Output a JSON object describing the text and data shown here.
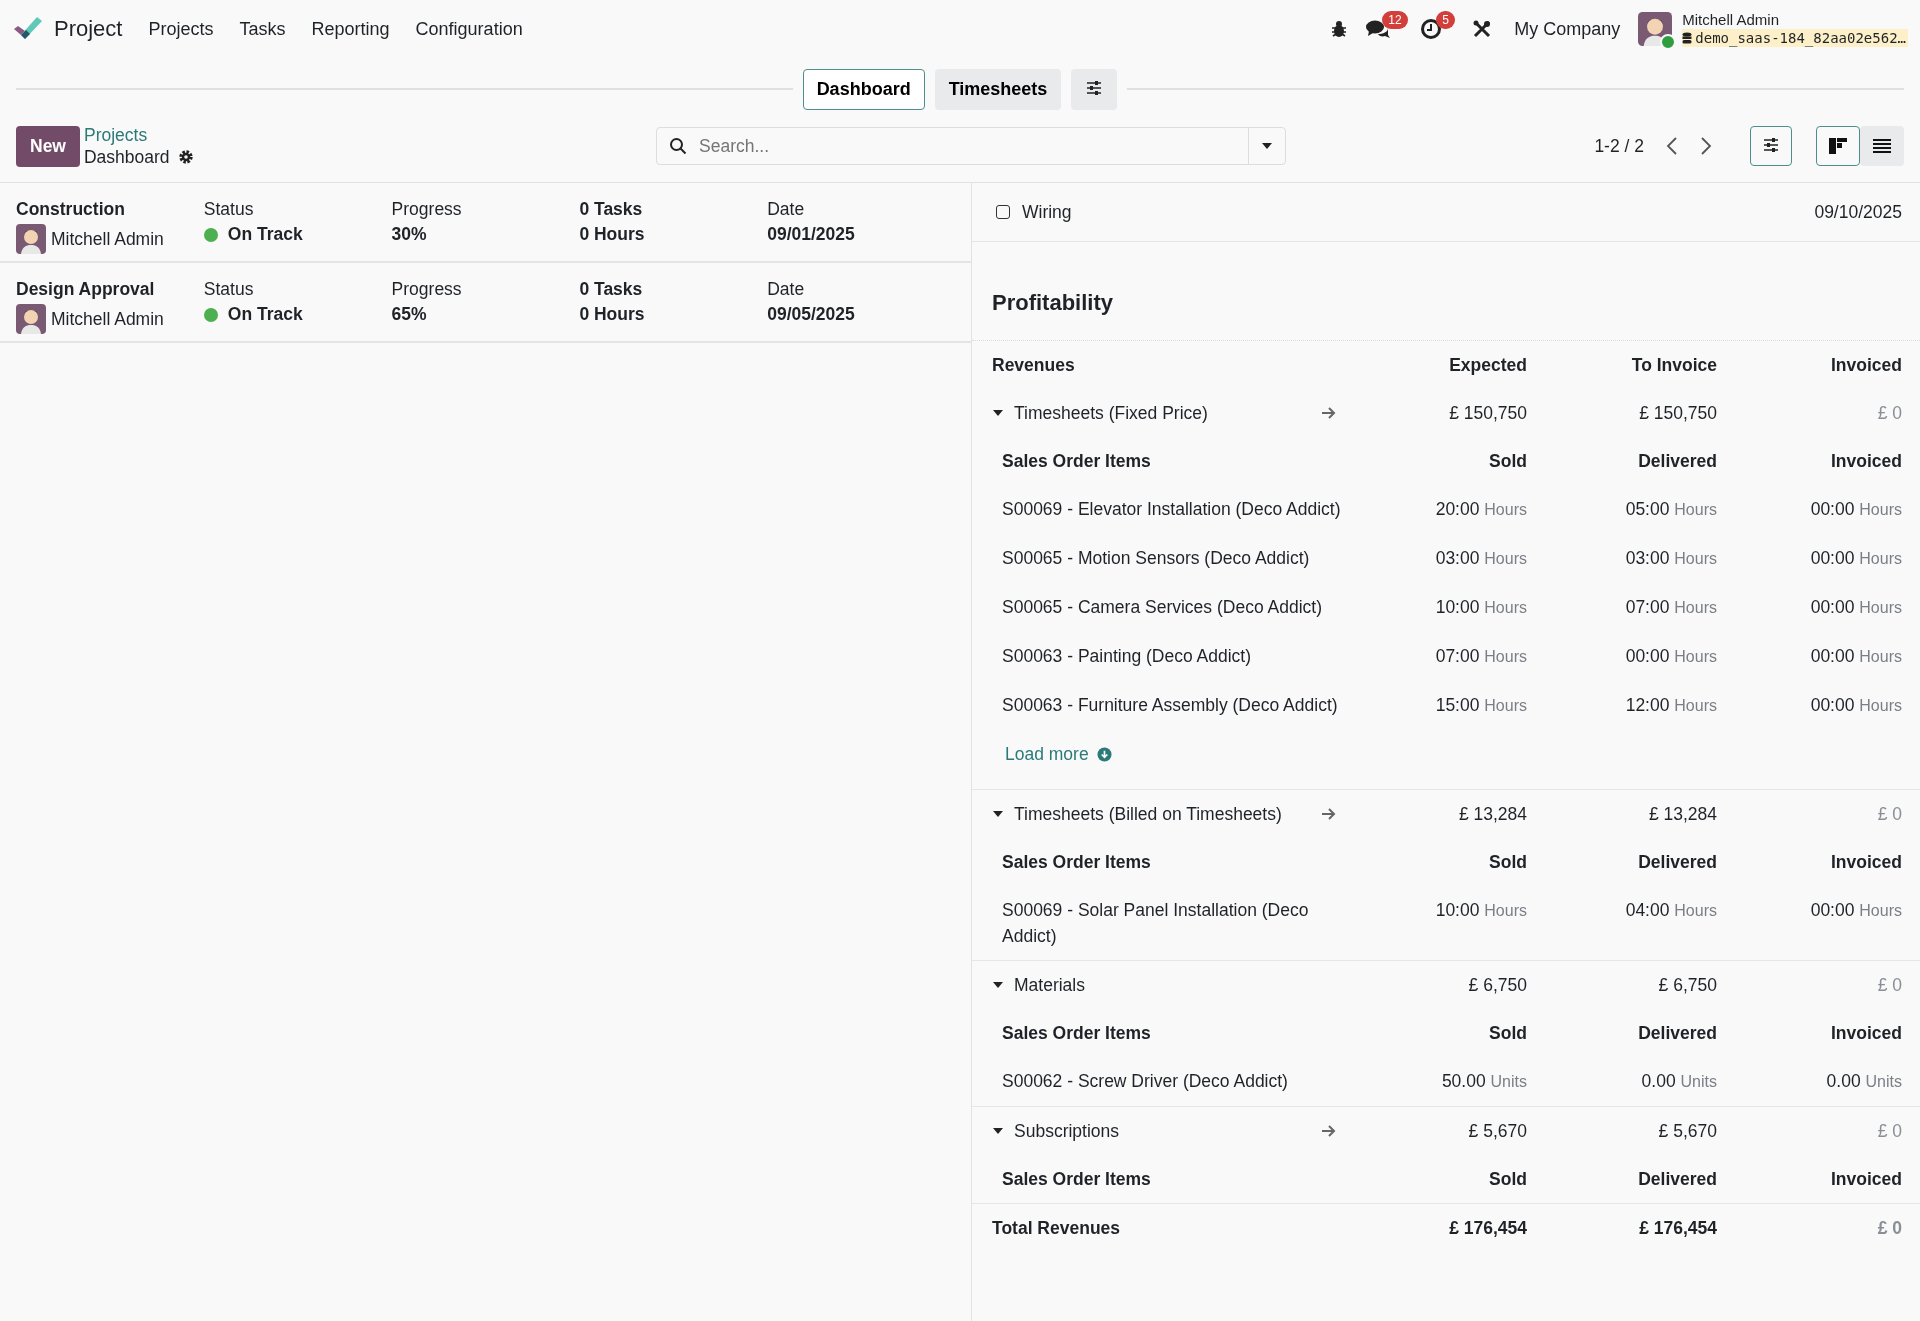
{
  "navbar": {
    "app_name": "Project",
    "menu": [
      "Projects",
      "Tasks",
      "Reporting",
      "Configuration"
    ],
    "messages_badge": "12",
    "activities_badge": "5",
    "company": "My Company",
    "user_name": "Mitchell Admin",
    "database": "demo_saas-184_82aa02e562…"
  },
  "view_tabs": [
    {
      "label": "Dashboard",
      "selected": true
    },
    {
      "label": "Timesheets",
      "selected": false
    }
  ],
  "control_panel": {
    "new_button": "New",
    "breadcrumb_parent": "Projects",
    "breadcrumb_current": "Dashboard",
    "search_placeholder": "Search...",
    "pager": "1-2 / 2",
    "views": [
      {
        "kind": "kanban",
        "selected": true
      },
      {
        "kind": "list",
        "selected": false
      }
    ]
  },
  "projects": [
    {
      "name": "Construction",
      "manager": "Mitchell Admin",
      "status_label": "Status",
      "status": "On Track",
      "color": "#4caf50",
      "progress_label": "Progress",
      "progress": "30%",
      "tasks": "0 Tasks",
      "hours": "0 Hours",
      "date_label": "Date",
      "date": "09/01/2025"
    },
    {
      "name": "Design Approval",
      "manager": "Mitchell Admin",
      "status_label": "Status",
      "status": "On Track",
      "color": "#4caf50",
      "progress_label": "Progress",
      "progress": "65%",
      "tasks": "0 Tasks",
      "hours": "0 Hours",
      "date_label": "Date",
      "date": "09/05/2025"
    }
  ],
  "milestone": {
    "name": "Wiring",
    "checked": false,
    "date": "09/10/2025"
  },
  "profitability": {
    "title": "Profitability",
    "columns": [
      "Revenues",
      "Expected",
      "To Invoice",
      "Invoiced"
    ],
    "sections": [
      {
        "name": "Timesheets (Fixed Price)",
        "expanded": true,
        "has_link": true,
        "expected": "£ 150,750",
        "to_invoice": "£ 150,750",
        "invoiced": "£ 0",
        "item_columns": [
          "Sales Order Items",
          "Sold",
          "Delivered",
          "Invoiced"
        ],
        "items": [
          {
            "name": "S00069 - Elevator Installation (Deco Addict)",
            "sold": "20:00",
            "sold_unit": "Hours",
            "delivered": "05:00",
            "delivered_unit": "Hours",
            "invoiced": "00:00",
            "invoiced_unit": "Hours"
          },
          {
            "name": "S00065 - Motion Sensors (Deco Addict)",
            "sold": "03:00",
            "sold_unit": "Hours",
            "delivered": "03:00",
            "delivered_unit": "Hours",
            "invoiced": "00:00",
            "invoiced_unit": "Hours"
          },
          {
            "name": "S00065 - Camera Services (Deco Addict)",
            "sold": "10:00",
            "sold_unit": "Hours",
            "delivered": "07:00",
            "delivered_unit": "Hours",
            "invoiced": "00:00",
            "invoiced_unit": "Hours"
          },
          {
            "name": "S00063 - Painting (Deco Addict)",
            "sold": "07:00",
            "sold_unit": "Hours",
            "delivered": "00:00",
            "delivered_unit": "Hours",
            "invoiced": "00:00",
            "invoiced_unit": "Hours"
          },
          {
            "name": "S00063 - Furniture Assembly (Deco Addict)",
            "sold": "15:00",
            "sold_unit": "Hours",
            "delivered": "12:00",
            "delivered_unit": "Hours",
            "invoiced": "00:00",
            "invoiced_unit": "Hours"
          }
        ],
        "load_more": "Load more"
      },
      {
        "name": "Timesheets (Billed on Timesheets)",
        "expanded": true,
        "has_link": true,
        "expected": "£ 13,284",
        "to_invoice": "£ 13,284",
        "invoiced": "£ 0",
        "item_columns": [
          "Sales Order Items",
          "Sold",
          "Delivered",
          "Invoiced"
        ],
        "items": [
          {
            "name": "S00069 - Solar Panel Installation (Deco Addict)",
            "sold": "10:00",
            "sold_unit": "Hours",
            "delivered": "04:00",
            "delivered_unit": "Hours",
            "invoiced": "00:00",
            "invoiced_unit": "Hours"
          }
        ]
      },
      {
        "name": "Materials",
        "expanded": true,
        "has_link": false,
        "expected": "£ 6,750",
        "to_invoice": "£ 6,750",
        "invoiced": "£ 0",
        "item_columns": [
          "Sales Order Items",
          "Sold",
          "Delivered",
          "Invoiced"
        ],
        "items": [
          {
            "name": "S00062 - Screw Driver (Deco Addict)",
            "sold": "50.00",
            "sold_unit": "Units",
            "delivered": "0.00",
            "delivered_unit": "Units",
            "invoiced": "0.00",
            "invoiced_unit": "Units"
          }
        ]
      },
      {
        "name": "Subscriptions",
        "expanded": true,
        "has_link": true,
        "expected": "£ 5,670",
        "to_invoice": "£ 5,670",
        "invoiced": "£ 0",
        "item_columns": [
          "Sales Order Items",
          "Sold",
          "Delivered",
          "Invoiced"
        ]
      }
    ],
    "total": {
      "label": "Total Revenues",
      "expected": "£ 176,454",
      "to_invoice": "£ 176,454",
      "invoiced": "£ 0"
    }
  }
}
